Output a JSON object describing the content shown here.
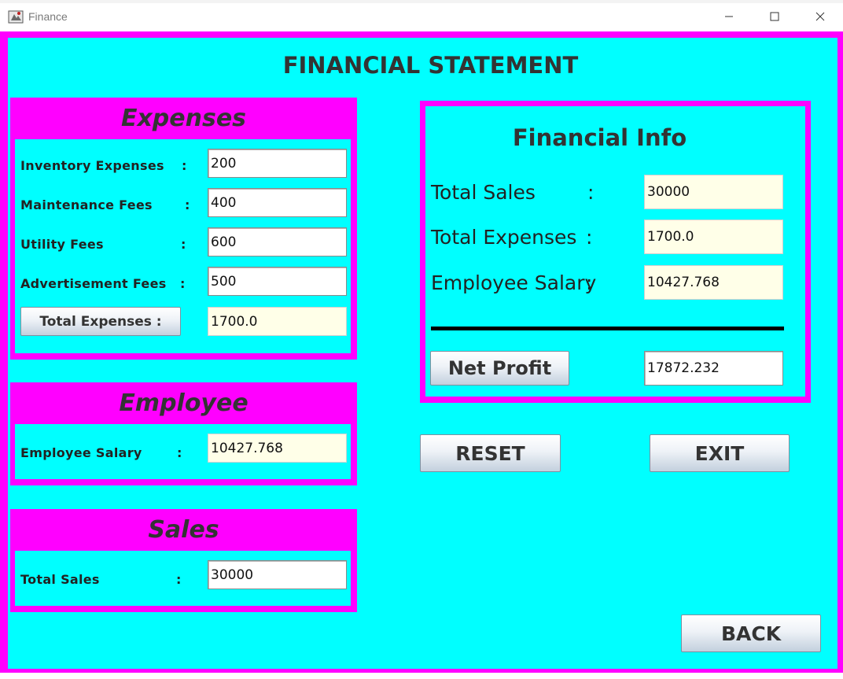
{
  "window": {
    "title": "Finance",
    "icons": {
      "app": "java-app-icon",
      "minimize": "minimize-icon",
      "maximize": "maximize-icon",
      "close": "close-icon"
    }
  },
  "colors": {
    "frame": "#ff00ff",
    "background": "#00ffff",
    "text": "#333333"
  },
  "main_title": "FINANCIAL STATEMENT",
  "expenses": {
    "heading": "Expenses",
    "inventory": {
      "label": "Inventory Expenses",
      "colon": ":",
      "value": "200"
    },
    "maintenance": {
      "label": "Maintenance Fees",
      "colon": ":",
      "value": "400"
    },
    "utility": {
      "label": "Utility Fees",
      "colon": ":",
      "value": "600"
    },
    "advertisement": {
      "label": "Advertisement Fees",
      "colon": ":",
      "value": "500"
    },
    "total_button": "Total Expenses :",
    "total_value": "1700.0"
  },
  "employee": {
    "heading": "Employee",
    "salary": {
      "label": "Employee Salary",
      "colon": ":",
      "value": "10427.768"
    }
  },
  "sales": {
    "heading": "Sales",
    "total": {
      "label": "Total Sales",
      "colon": ":",
      "value": "30000"
    }
  },
  "info": {
    "heading": "Financial Info",
    "total_sales": {
      "label": "Total Sales",
      "colon": ":",
      "value": "30000"
    },
    "total_expenses": {
      "label": "Total Expenses",
      "colon": ":",
      "value": "1700.0"
    },
    "employee_salary": {
      "label": "Employee Salary",
      "colon": ":",
      "value": "10427.768"
    },
    "net_profit_button": "Net Profit",
    "net_profit_value": "17872.232"
  },
  "buttons": {
    "reset": "RESET",
    "exit": "EXIT",
    "back": "BACK"
  }
}
